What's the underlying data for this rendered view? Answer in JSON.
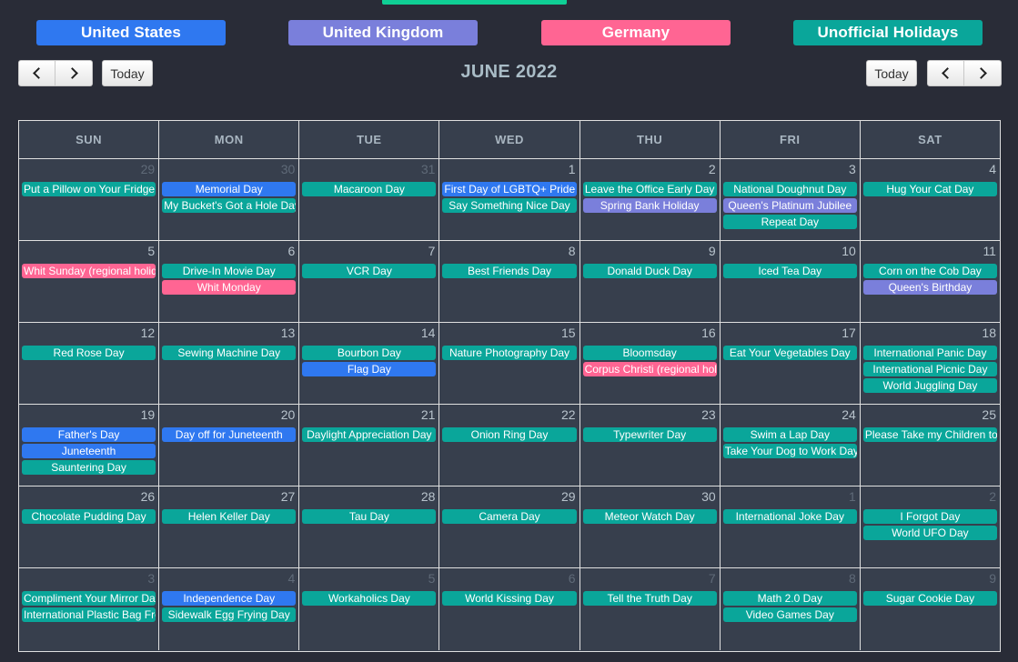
{
  "legend": [
    {
      "label": "United States",
      "key": "us",
      "color": "#2f78f0"
    },
    {
      "label": "United Kingdom",
      "key": "uk",
      "color": "#7a7fdb"
    },
    {
      "label": "Germany",
      "key": "de",
      "color": "#ff6593"
    },
    {
      "label": "Unofficial Holidays",
      "key": "un",
      "color": "#0aa69a"
    }
  ],
  "toolbar": {
    "prev_label": "prev",
    "next_label": "next",
    "today_label": "Today",
    "title": "JUNE 2022"
  },
  "weekdays": [
    "SUN",
    "MON",
    "TUE",
    "WED",
    "THU",
    "FRI",
    "SAT"
  ],
  "weeks": [
    [
      {
        "day": "29",
        "other": true,
        "events": [
          {
            "t": "Put a Pillow on Your Fridge Day",
            "c": "un",
            "left": true
          }
        ]
      },
      {
        "day": "30",
        "other": true,
        "events": [
          {
            "t": "Memorial Day",
            "c": "us"
          },
          {
            "t": "My Bucket's Got a Hole Day",
            "c": "un"
          }
        ]
      },
      {
        "day": "31",
        "other": true,
        "events": [
          {
            "t": "Macaroon Day",
            "c": "un"
          }
        ]
      },
      {
        "day": "1",
        "other": false,
        "events": [
          {
            "t": "First Day of LGBTQ+ Pride Month",
            "c": "us",
            "left": true
          },
          {
            "t": "Say Something Nice Day",
            "c": "un"
          }
        ]
      },
      {
        "day": "2",
        "other": false,
        "events": [
          {
            "t": "Leave the Office Early Day",
            "c": "un"
          },
          {
            "t": "Spring Bank Holiday",
            "c": "uk"
          }
        ]
      },
      {
        "day": "3",
        "other": false,
        "events": [
          {
            "t": "National Doughnut Day",
            "c": "un"
          },
          {
            "t": "Queen's Platinum Jubilee",
            "c": "uk"
          },
          {
            "t": "Repeat Day",
            "c": "un"
          }
        ]
      },
      {
        "day": "4",
        "other": false,
        "events": [
          {
            "t": "Hug Your Cat Day",
            "c": "un"
          }
        ]
      }
    ],
    [
      {
        "day": "5",
        "other": false,
        "events": [
          {
            "t": "Whit Sunday (regional holiday)",
            "c": "de",
            "left": true
          }
        ]
      },
      {
        "day": "6",
        "other": false,
        "events": [
          {
            "t": "Drive-In Movie Day",
            "c": "un"
          },
          {
            "t": "Whit Monday",
            "c": "de"
          }
        ]
      },
      {
        "day": "7",
        "other": false,
        "events": [
          {
            "t": "VCR Day",
            "c": "un"
          }
        ]
      },
      {
        "day": "8",
        "other": false,
        "events": [
          {
            "t": "Best Friends Day",
            "c": "un"
          }
        ]
      },
      {
        "day": "9",
        "other": false,
        "events": [
          {
            "t": "Donald Duck Day",
            "c": "un"
          }
        ]
      },
      {
        "day": "10",
        "other": false,
        "events": [
          {
            "t": "Iced Tea Day",
            "c": "un"
          }
        ]
      },
      {
        "day": "11",
        "other": false,
        "events": [
          {
            "t": "Corn on the Cob Day",
            "c": "un"
          },
          {
            "t": "Queen's Birthday",
            "c": "uk"
          }
        ]
      }
    ],
    [
      {
        "day": "12",
        "other": false,
        "events": [
          {
            "t": "Red Rose Day",
            "c": "un"
          }
        ]
      },
      {
        "day": "13",
        "other": false,
        "events": [
          {
            "t": "Sewing Machine Day",
            "c": "un"
          }
        ]
      },
      {
        "day": "14",
        "other": false,
        "events": [
          {
            "t": "Bourbon Day",
            "c": "un"
          },
          {
            "t": "Flag Day",
            "c": "us"
          }
        ]
      },
      {
        "day": "15",
        "other": false,
        "events": [
          {
            "t": "Nature Photography Day",
            "c": "un"
          }
        ]
      },
      {
        "day": "16",
        "other": false,
        "events": [
          {
            "t": "Bloomsday",
            "c": "un"
          },
          {
            "t": "Corpus Christi (regional holiday)",
            "c": "de",
            "left": true
          }
        ]
      },
      {
        "day": "17",
        "other": false,
        "events": [
          {
            "t": "Eat Your Vegetables Day",
            "c": "un"
          }
        ]
      },
      {
        "day": "18",
        "other": false,
        "events": [
          {
            "t": "International Panic Day",
            "c": "un"
          },
          {
            "t": "International Picnic Day",
            "c": "un"
          },
          {
            "t": "World Juggling Day",
            "c": "un"
          }
        ]
      }
    ],
    [
      {
        "day": "19",
        "other": false,
        "events": [
          {
            "t": "Father's Day",
            "c": "us"
          },
          {
            "t": "Juneteenth",
            "c": "us"
          },
          {
            "t": "Sauntering Day",
            "c": "un"
          }
        ]
      },
      {
        "day": "20",
        "other": false,
        "events": [
          {
            "t": "Day off for Juneteenth",
            "c": "us"
          }
        ]
      },
      {
        "day": "21",
        "other": false,
        "events": [
          {
            "t": "Daylight Appreciation Day",
            "c": "un"
          }
        ]
      },
      {
        "day": "22",
        "other": false,
        "events": [
          {
            "t": "Onion Ring Day",
            "c": "un"
          }
        ]
      },
      {
        "day": "23",
        "other": false,
        "events": [
          {
            "t": "Typewriter Day",
            "c": "un"
          }
        ]
      },
      {
        "day": "24",
        "other": false,
        "events": [
          {
            "t": "Swim a Lap Day",
            "c": "un"
          },
          {
            "t": "Take Your Dog to Work Day",
            "c": "un"
          }
        ]
      },
      {
        "day": "25",
        "other": false,
        "events": [
          {
            "t": "Please Take my Children to Work Day",
            "c": "un",
            "left": true
          }
        ]
      }
    ],
    [
      {
        "day": "26",
        "other": false,
        "events": [
          {
            "t": "Chocolate Pudding Day",
            "c": "un"
          }
        ]
      },
      {
        "day": "27",
        "other": false,
        "events": [
          {
            "t": "Helen Keller Day",
            "c": "un"
          }
        ]
      },
      {
        "day": "28",
        "other": false,
        "events": [
          {
            "t": "Tau Day",
            "c": "un"
          }
        ]
      },
      {
        "day": "29",
        "other": false,
        "events": [
          {
            "t": "Camera Day",
            "c": "un"
          }
        ]
      },
      {
        "day": "30",
        "other": false,
        "events": [
          {
            "t": "Meteor Watch Day",
            "c": "un"
          }
        ]
      },
      {
        "day": "1",
        "other": true,
        "events": [
          {
            "t": "International Joke Day",
            "c": "un"
          }
        ]
      },
      {
        "day": "2",
        "other": true,
        "events": [
          {
            "t": "I Forgot Day",
            "c": "un"
          },
          {
            "t": "World UFO Day",
            "c": "un"
          }
        ]
      }
    ],
    [
      {
        "day": "3",
        "other": true,
        "events": [
          {
            "t": "Compliment Your Mirror Day",
            "c": "un",
            "left": true
          },
          {
            "t": "International Plastic Bag Free Day",
            "c": "un",
            "left": true
          }
        ]
      },
      {
        "day": "4",
        "other": true,
        "events": [
          {
            "t": "Independence Day",
            "c": "us"
          },
          {
            "t": "Sidewalk Egg Frying Day",
            "c": "un"
          }
        ]
      },
      {
        "day": "5",
        "other": true,
        "events": [
          {
            "t": "Workaholics Day",
            "c": "un"
          }
        ]
      },
      {
        "day": "6",
        "other": true,
        "events": [
          {
            "t": "World Kissing Day",
            "c": "un"
          }
        ]
      },
      {
        "day": "7",
        "other": true,
        "events": [
          {
            "t": "Tell the Truth Day",
            "c": "un"
          }
        ]
      },
      {
        "day": "8",
        "other": true,
        "events": [
          {
            "t": "Math 2.0 Day",
            "c": "un"
          },
          {
            "t": "Video Games Day",
            "c": "un"
          }
        ]
      },
      {
        "day": "9",
        "other": true,
        "events": [
          {
            "t": "Sugar Cookie Day",
            "c": "un"
          }
        ]
      }
    ]
  ]
}
